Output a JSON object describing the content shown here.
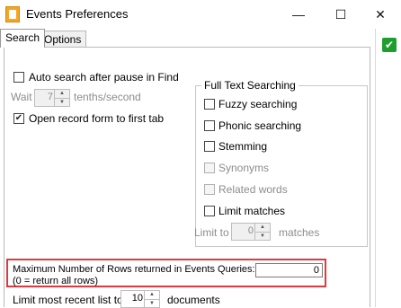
{
  "window": {
    "title": "Events Preferences",
    "minimize_glyph": "—",
    "maximize_glyph": "☐",
    "close_glyph": "✕"
  },
  "tabs": [
    {
      "label": "Search",
      "active": true
    },
    {
      "label": "Options",
      "active": false
    }
  ],
  "search": {
    "auto_search_label": "Auto search after pause in Find",
    "auto_search_checked": false,
    "wait_label": "Wait",
    "wait_value": "7",
    "wait_unit": "tenths/second",
    "open_record_label": "Open record form to first tab",
    "open_record_checked": true
  },
  "full_text": {
    "title": "Full Text Searching",
    "options": [
      {
        "label": "Fuzzy searching",
        "checked": false,
        "enabled": true
      },
      {
        "label": "Phonic searching",
        "checked": false,
        "enabled": true
      },
      {
        "label": "Stemming",
        "checked": false,
        "enabled": true
      },
      {
        "label": "Synonyms",
        "checked": false,
        "enabled": false
      },
      {
        "label": "Related words",
        "checked": false,
        "enabled": false
      },
      {
        "label": "Limit matches",
        "checked": false,
        "enabled": true
      }
    ],
    "limit_to_label": "Limit to",
    "limit_value": "0",
    "matches_label": "matches"
  },
  "max_rows": {
    "label": "Maximum Number of Rows returned in Events Queries:",
    "note": "(0 = return all rows)",
    "value": "0"
  },
  "recent": {
    "label": "Limit most recent list to",
    "value": "10",
    "unit": "documents"
  },
  "ok_glyph": "✔",
  "colors": {
    "highlight": "#e0393e",
    "ok_green": "#1f9d2e"
  }
}
